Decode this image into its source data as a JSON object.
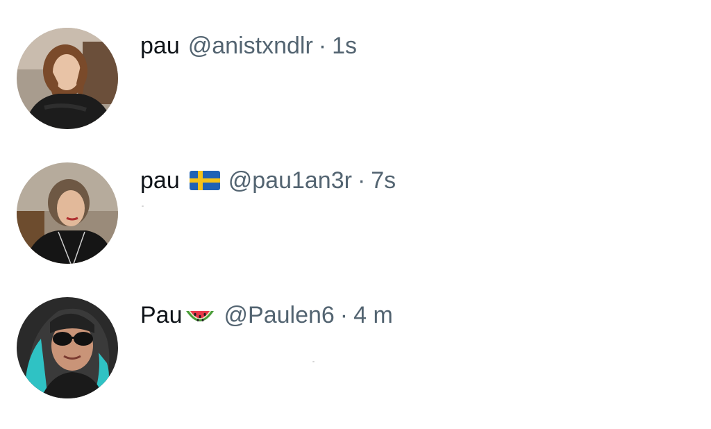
{
  "posts": [
    {
      "display_name": "pau",
      "handle": "@anistxndlr",
      "separator": "·",
      "time": "1s",
      "emoji": null
    },
    {
      "display_name": "pau",
      "handle": "@pau1an3r",
      "separator": "·",
      "time": "7s",
      "emoji": "sweden-flag-icon"
    },
    {
      "display_name": "Pau",
      "handle": "@Paulen6",
      "separator": "·",
      "time": "4 m",
      "emoji": "watermelon-icon"
    }
  ],
  "colors": {
    "name_text": "#0f1419",
    "secondary_text": "#536471",
    "background": "#ffffff",
    "flag_blue": "#1f62b5",
    "flag_yellow": "#f4c21a",
    "hair_teal": "#2fc2c4"
  }
}
